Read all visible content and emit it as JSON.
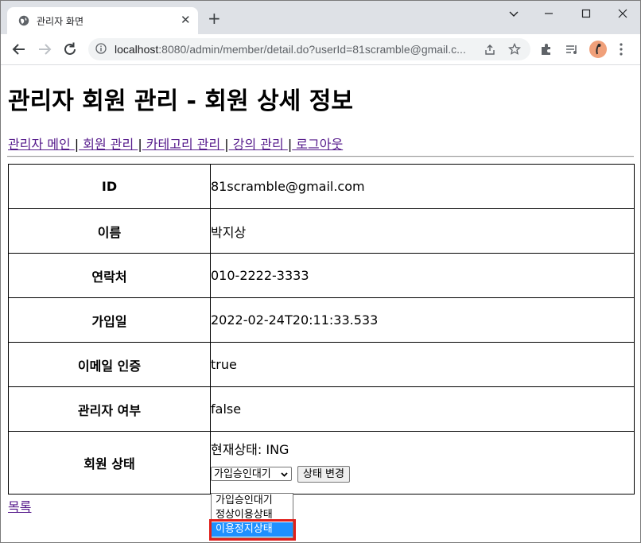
{
  "browser": {
    "tab_title": "관리자 화면",
    "new_tab_symbol": "+",
    "close_symbol": "✕",
    "url_host": "localhost",
    "url_rest": ":8080/admin/member/detail.do?userId=81scramble@gmail.c...",
    "window_controls": {
      "minimize": "—",
      "maximize": "☐",
      "close": "✕"
    }
  },
  "page": {
    "heading": "관리자 회원 관리 - 회원 상세 정보",
    "nav": [
      {
        "label": "관리자 메인 "
      },
      {
        "label": " 회원 관리 "
      },
      {
        "label": " 카테고리 관리 "
      },
      {
        "label": " 강의 관리 "
      },
      {
        "label": " 로그아웃"
      }
    ],
    "nav_separator": "|",
    "rows": [
      {
        "label": "ID",
        "value": "81scramble@gmail.com"
      },
      {
        "label": "이름",
        "value": "박지상"
      },
      {
        "label": "연락처",
        "value": "010-2222-3333"
      },
      {
        "label": "가입일",
        "value": "2022-02-24T20:11:33.533"
      },
      {
        "label": "이메일 인증",
        "value": "true"
      },
      {
        "label": "관리자 여부",
        "value": "false"
      }
    ],
    "status_row": {
      "label": "회원 상태",
      "current_status": "현재상태: ING",
      "select_value": "가입승인대기",
      "change_button": "상태 변경",
      "options": [
        "가입승인대기",
        "정상이용상태",
        "이용정지상태"
      ],
      "highlighted_option": "이용정지상태"
    },
    "list_link": "목록"
  },
  "colors": {
    "tabstrip_bg": "#dee1e6",
    "link": "#551a8b",
    "option_highlight": "#1e90ff",
    "annotation_box": "#e0201c"
  }
}
